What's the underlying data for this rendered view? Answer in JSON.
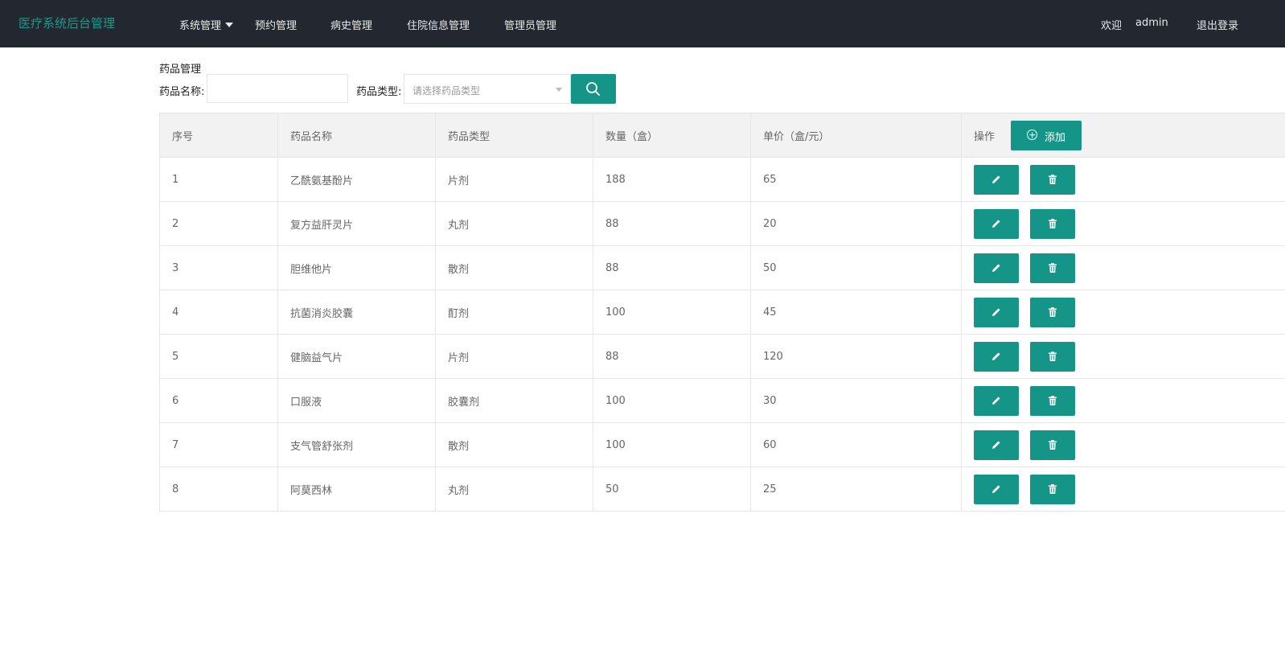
{
  "app": {
    "brand": "医疗系统后台管理"
  },
  "nav": {
    "items": [
      {
        "label": "系统管理",
        "has_dropdown": true
      },
      {
        "label": "预约管理"
      },
      {
        "label": "病史管理"
      },
      {
        "label": "住院信息管理"
      },
      {
        "label": "管理员管理"
      }
    ],
    "welcome": "欢迎",
    "username": "admin",
    "logout": "退出登录"
  },
  "search": {
    "section_title": "药品管理",
    "name_label": "药品名称:",
    "name_value": "",
    "type_label": "药品类型:",
    "type_placeholder": "请选择药品类型",
    "search_icon": "search-icon"
  },
  "table": {
    "columns": [
      "序号",
      "药品名称",
      "药品类型",
      "数量（盒）",
      "单价（盒/元）",
      "操作"
    ],
    "add_button_label": "添加",
    "rows": [
      {
        "id": "1",
        "name": "乙酰氨基酚片",
        "type": "片剂",
        "qty": "188",
        "price": "65"
      },
      {
        "id": "2",
        "name": "复方益肝灵片",
        "type": "丸剂",
        "qty": "88",
        "price": "20"
      },
      {
        "id": "3",
        "name": "胆维他片",
        "type": "散剂",
        "qty": "88",
        "price": "50"
      },
      {
        "id": "4",
        "name": "抗菌消炎胶囊",
        "type": "酊剂",
        "qty": "100",
        "price": "45"
      },
      {
        "id": "5",
        "name": "健脑益气片",
        "type": "片剂",
        "qty": "88",
        "price": "120"
      },
      {
        "id": "6",
        "name": "口服液",
        "type": "胶囊剂",
        "qty": "100",
        "price": "30"
      },
      {
        "id": "7",
        "name": "支气管舒张剂",
        "type": "散剂",
        "qty": "100",
        "price": "60"
      },
      {
        "id": "8",
        "name": "阿莫西林",
        "type": "丸剂",
        "qty": "50",
        "price": "25"
      }
    ],
    "row_icons": [
      "edit-icon",
      "trash-icon"
    ]
  },
  "colors": {
    "navbar": "#232730",
    "brand": "#1a9a8a",
    "accent": "#159587"
  }
}
